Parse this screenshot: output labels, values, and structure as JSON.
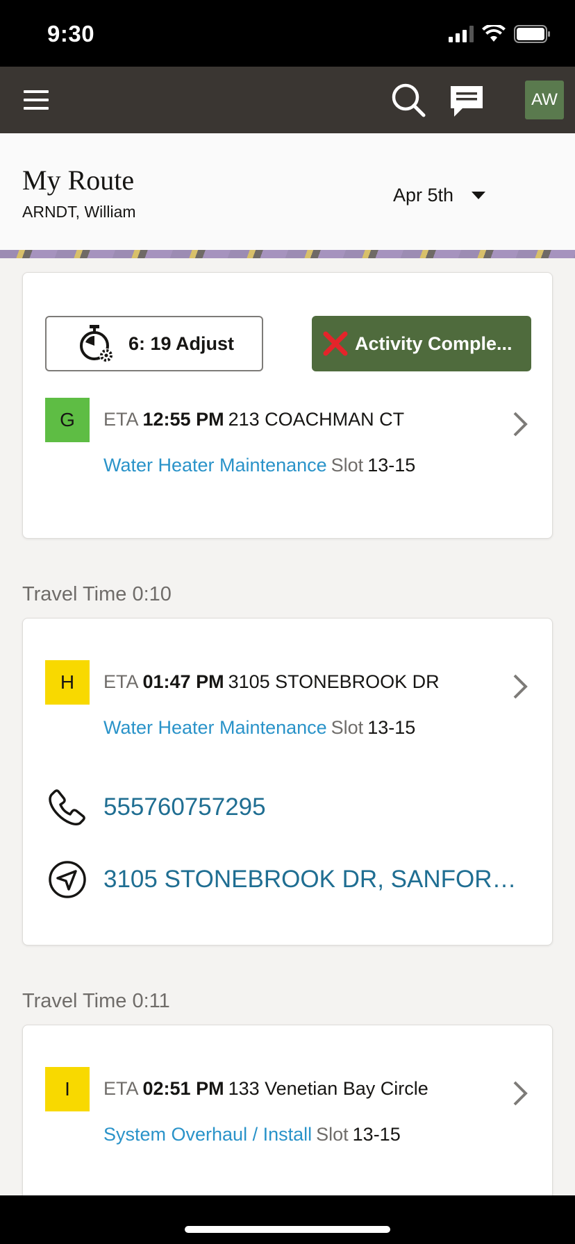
{
  "status_bar": {
    "time": "9:30"
  },
  "app_bar": {
    "avatar_initials": "AW"
  },
  "header": {
    "title": "My Route",
    "subtitle": "ARNDT, William",
    "date": "Apr 5th"
  },
  "actions": {
    "adjust_label": "6: 19 Adjust",
    "complete_label": "Activity Comple..."
  },
  "activities": [
    {
      "letter": "G",
      "eta_prefix": "ETA",
      "eta_time": "12:55 PM",
      "address": "213 COACHMAN CT",
      "type": "Water Heater Maintenance",
      "slot_label": "Slot",
      "slot": "13-15"
    },
    {
      "letter": "H",
      "eta_prefix": "ETA",
      "eta_time": "01:47 PM",
      "address": "3105 STONEBROOK DR",
      "type": "Water Heater Maintenance",
      "slot_label": "Slot",
      "slot": "13-15",
      "phone": "555760757295",
      "full_address": "3105 STONEBROOK DR, SANFORD,..."
    },
    {
      "letter": "I",
      "eta_prefix": "ETA",
      "eta_time": "02:51 PM",
      "address": "133 Venetian Bay Circle",
      "type": "System Overhaul / Install",
      "slot_label": "Slot",
      "slot": "13-15"
    }
  ],
  "travel_times": [
    "Travel Time 0:10",
    "Travel Time 0:11"
  ],
  "colors": {
    "app_bar": "#3a3632",
    "complete_button": "#4f6b3d",
    "badge_green": "#5ebd44",
    "badge_yellow": "#f8d900",
    "link_blue": "#2a93c9"
  },
  "icons": [
    "menu-icon",
    "search-icon",
    "chat-icon",
    "stopwatch-gear-icon",
    "close-x-icon",
    "chevron-right-icon",
    "phone-icon",
    "navigation-icon"
  ]
}
